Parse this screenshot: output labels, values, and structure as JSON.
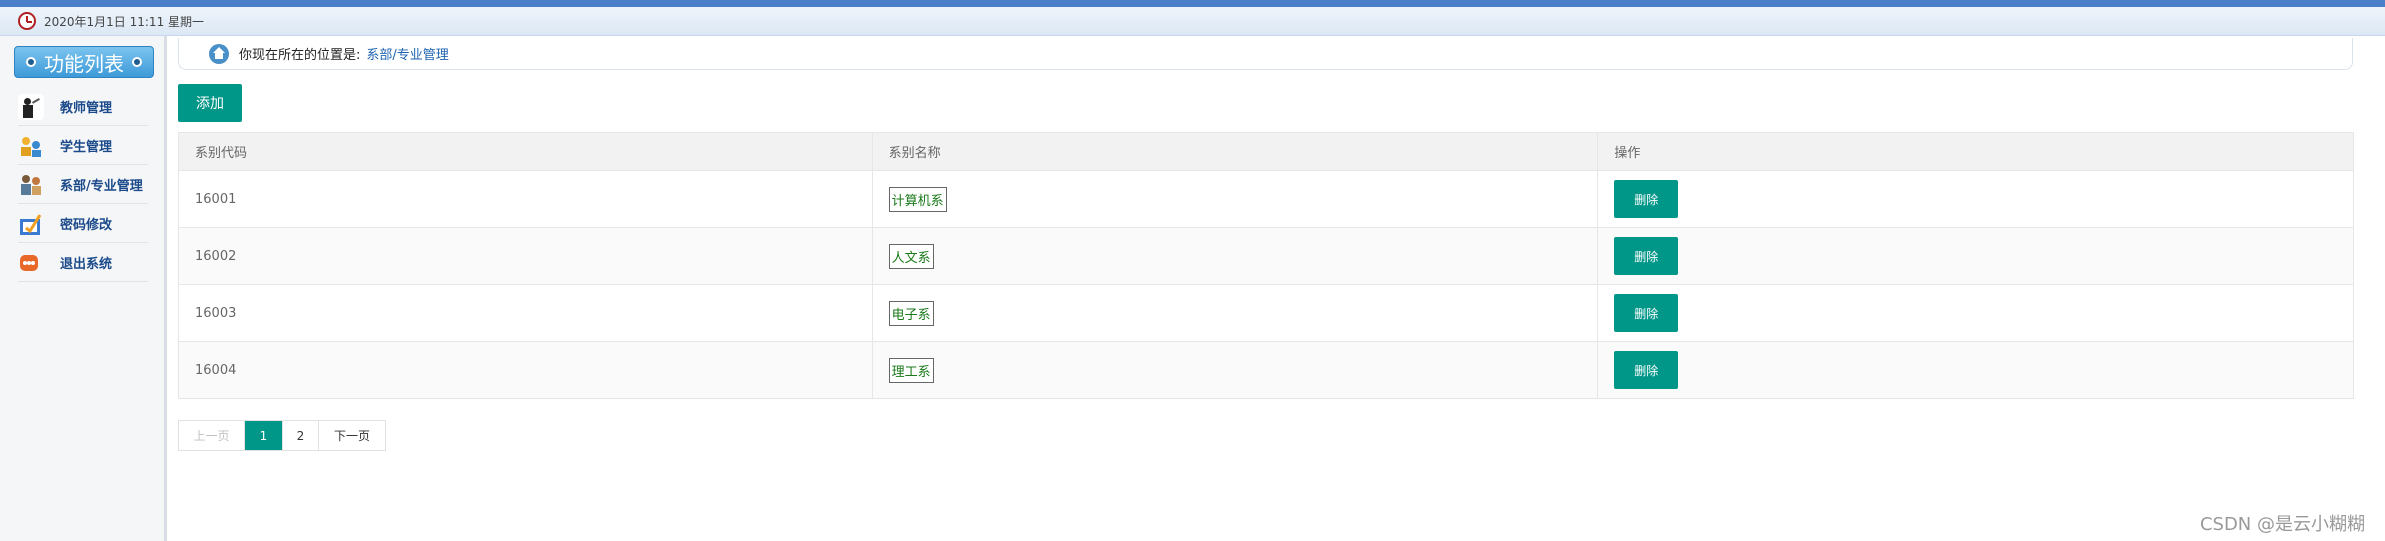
{
  "header": {
    "datetime": "2020年1月1日 11:11 星期一"
  },
  "sidebar": {
    "title": "功能列表",
    "items": [
      {
        "label": "教师管理",
        "icon": "teacher-icon"
      },
      {
        "label": "学生管理",
        "icon": "student-icon"
      },
      {
        "label": "系部/专业管理",
        "icon": "department-icon"
      },
      {
        "label": "密码修改",
        "icon": "password-icon"
      },
      {
        "label": "退出系统",
        "icon": "logout-icon"
      }
    ]
  },
  "location": {
    "label": "你现在所在的位置是:",
    "current": "系部/专业管理"
  },
  "toolbar": {
    "add_label": "添加"
  },
  "table": {
    "headers": [
      "系别代码",
      "系别名称",
      "操作"
    ],
    "rows": [
      {
        "code": "16001",
        "name": "计算机系",
        "action": "删除"
      },
      {
        "code": "16002",
        "name": "人文系",
        "action": "删除"
      },
      {
        "code": "16003",
        "name": "电子系",
        "action": "删除"
      },
      {
        "code": "16004",
        "name": "理工系",
        "action": "删除"
      }
    ]
  },
  "pagination": {
    "prev": "上一页",
    "pages": [
      "1",
      "2"
    ],
    "current": "1",
    "next": "下一页"
  },
  "watermark": "CSDN @是云小糊糊",
  "colors": {
    "accent": "#009688",
    "link": "#1d63b0",
    "nav_text": "#1b4a8a"
  }
}
